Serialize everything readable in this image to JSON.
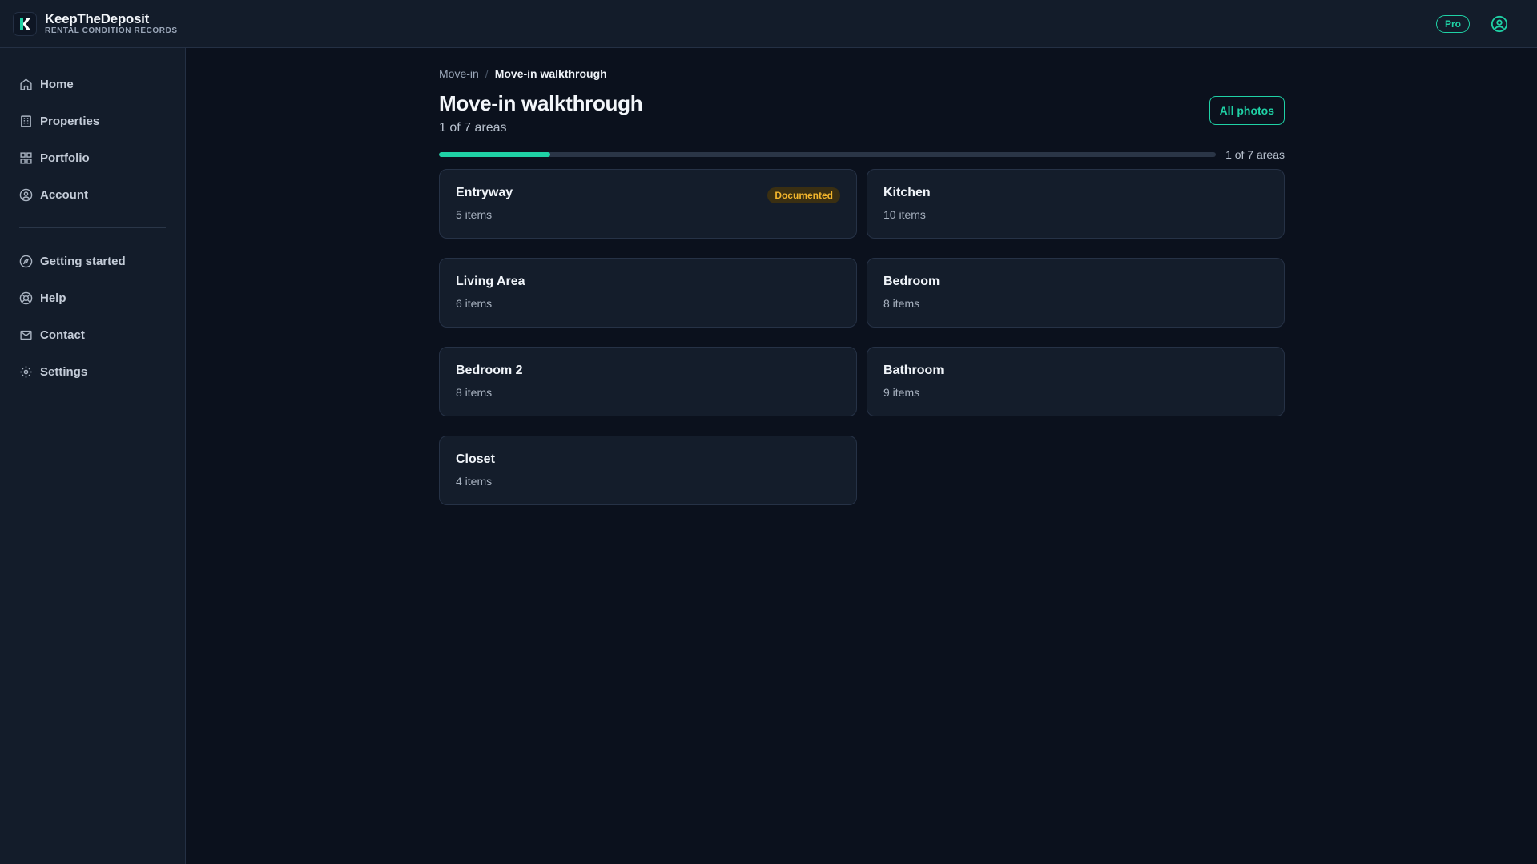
{
  "brand": {
    "name": "KeepTheDeposit",
    "tagline": "RENTAL CONDITION RECORDS",
    "logo_letter": "K"
  },
  "header": {
    "plan_badge": "Pro"
  },
  "sidebar": {
    "items": [
      {
        "label": "Home",
        "icon": "home-icon"
      },
      {
        "label": "Properties",
        "icon": "building-icon"
      },
      {
        "label": "Portfolio",
        "icon": "grid-icon"
      },
      {
        "label": "Account",
        "icon": "user-circle-icon"
      }
    ],
    "secondary_items": [
      {
        "label": "Getting started",
        "icon": "compass-icon"
      },
      {
        "label": "Help",
        "icon": "lifebuoy-icon"
      },
      {
        "label": "Contact",
        "icon": "mail-icon"
      },
      {
        "label": "Settings",
        "icon": "gear-icon"
      }
    ]
  },
  "breadcrumb": {
    "parent": "Move-in",
    "separator": "/",
    "current": "Move-in walkthrough"
  },
  "page": {
    "title": "Move-in walkthrough",
    "subtitle": "1 of 7 areas",
    "all_photos_label": "All photos"
  },
  "progress": {
    "completed": 1,
    "total": 7,
    "label": "1 of 7 areas"
  },
  "areas": [
    {
      "name": "Entryway",
      "items": "5 items",
      "status": "Documented"
    },
    {
      "name": "Kitchen",
      "items": "10 items",
      "status": ""
    },
    {
      "name": "Living Area",
      "items": "6 items",
      "status": ""
    },
    {
      "name": "Bedroom",
      "items": "8 items",
      "status": ""
    },
    {
      "name": "Bedroom 2",
      "items": "8 items",
      "status": ""
    },
    {
      "name": "Bathroom",
      "items": "9 items",
      "status": ""
    },
    {
      "name": "Closet",
      "items": "4 items",
      "status": ""
    }
  ],
  "colors": {
    "accent": "#1fd1a5",
    "documented_badge_bg": "#3a2f12",
    "documented_badge_text": "#f2b52c"
  }
}
